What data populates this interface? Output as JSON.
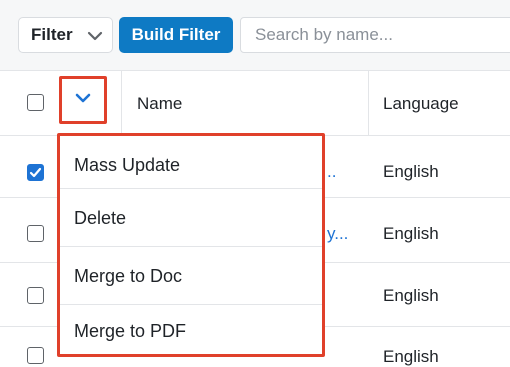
{
  "toolbar": {
    "filter_label": "Filter",
    "build_filter_label": "Build Filter",
    "search_placeholder": "Search by name..."
  },
  "table": {
    "columns": [
      "Name",
      "Language"
    ],
    "rows": [
      {
        "selected": true,
        "name_fragment": "..",
        "language": "English"
      },
      {
        "selected": false,
        "name_fragment": "y...",
        "language": "English"
      },
      {
        "selected": false,
        "name_fragment": "",
        "language": "English"
      },
      {
        "selected": false,
        "name_fragment": "",
        "language": "English"
      }
    ]
  },
  "mass_actions": {
    "items": [
      "Mass Update",
      "Delete",
      "Merge to Doc",
      "Merge to PDF"
    ]
  },
  "colors": {
    "accent_blue": "#0e7ac4",
    "highlight_red": "#e0402a",
    "checkbox_blue": "#1e73d4"
  },
  "icons": [
    "chevron-down-icon",
    "checkmark-icon"
  ]
}
